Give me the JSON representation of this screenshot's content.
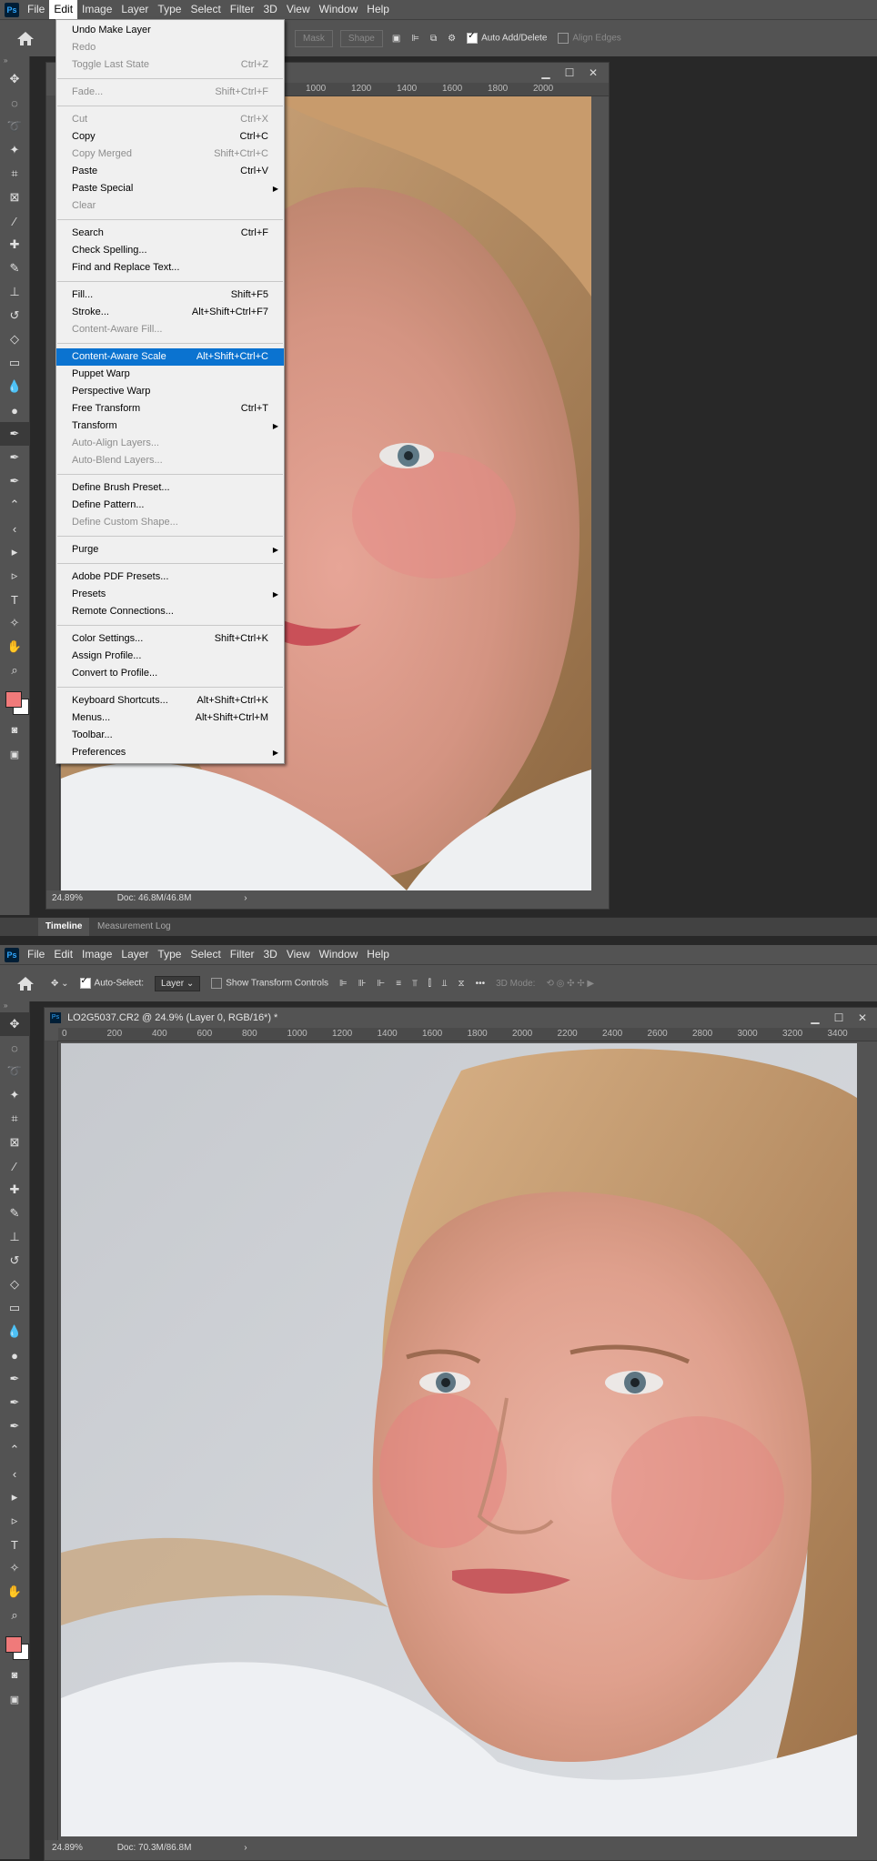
{
  "menubar": {
    "logo": "Ps",
    "items": [
      "File",
      "Edit",
      "Image",
      "Layer",
      "Type",
      "Select",
      "Filter",
      "3D",
      "View",
      "Window",
      "Help"
    ]
  },
  "top_options": {
    "mask_label": "Mask",
    "shape_label": "Shape",
    "auto_add_delete": "Auto Add/Delete",
    "align_edges": "Align Edges"
  },
  "top_document": {
    "ruler_ticks": [
      "1000",
      "1200",
      "1400",
      "1600",
      "1800",
      "2000"
    ],
    "zoom": "24.89%",
    "doc_info": "Doc: 46.8M/46.8M"
  },
  "edit_menu": {
    "groups": [
      [
        {
          "label": "Undo Make Layer",
          "shortcut": "",
          "enabled": true
        },
        {
          "label": "Redo",
          "shortcut": "",
          "enabled": false
        },
        {
          "label": "Toggle Last State",
          "shortcut": "Ctrl+Z",
          "enabled": false
        }
      ],
      [
        {
          "label": "Fade...",
          "shortcut": "Shift+Ctrl+F",
          "enabled": false
        }
      ],
      [
        {
          "label": "Cut",
          "shortcut": "Ctrl+X",
          "enabled": false
        },
        {
          "label": "Copy",
          "shortcut": "Ctrl+C",
          "enabled": true
        },
        {
          "label": "Copy Merged",
          "shortcut": "Shift+Ctrl+C",
          "enabled": false
        },
        {
          "label": "Paste",
          "shortcut": "Ctrl+V",
          "enabled": true
        },
        {
          "label": "Paste Special",
          "shortcut": "",
          "enabled": true,
          "submenu": true
        },
        {
          "label": "Clear",
          "shortcut": "",
          "enabled": false
        }
      ],
      [
        {
          "label": "Search",
          "shortcut": "Ctrl+F",
          "enabled": true
        },
        {
          "label": "Check Spelling...",
          "shortcut": "",
          "enabled": true
        },
        {
          "label": "Find and Replace Text...",
          "shortcut": "",
          "enabled": true
        }
      ],
      [
        {
          "label": "Fill...",
          "shortcut": "Shift+F5",
          "enabled": true
        },
        {
          "label": "Stroke...",
          "shortcut": "Alt+Shift+Ctrl+F7",
          "enabled": true
        },
        {
          "label": "Content-Aware Fill...",
          "shortcut": "",
          "enabled": false
        }
      ],
      [
        {
          "label": "Content-Aware Scale",
          "shortcut": "Alt+Shift+Ctrl+C",
          "enabled": true,
          "highlighted": true
        },
        {
          "label": "Puppet Warp",
          "shortcut": "",
          "enabled": true
        },
        {
          "label": "Perspective Warp",
          "shortcut": "",
          "enabled": true
        },
        {
          "label": "Free Transform",
          "shortcut": "Ctrl+T",
          "enabled": true
        },
        {
          "label": "Transform",
          "shortcut": "",
          "enabled": true,
          "submenu": true
        },
        {
          "label": "Auto-Align Layers...",
          "shortcut": "",
          "enabled": false
        },
        {
          "label": "Auto-Blend Layers...",
          "shortcut": "",
          "enabled": false
        }
      ],
      [
        {
          "label": "Define Brush Preset...",
          "shortcut": "",
          "enabled": true
        },
        {
          "label": "Define Pattern...",
          "shortcut": "",
          "enabled": true
        },
        {
          "label": "Define Custom Shape...",
          "shortcut": "",
          "enabled": false
        }
      ],
      [
        {
          "label": "Purge",
          "shortcut": "",
          "enabled": true,
          "submenu": true
        }
      ],
      [
        {
          "label": "Adobe PDF Presets...",
          "shortcut": "",
          "enabled": true
        },
        {
          "label": "Presets",
          "shortcut": "",
          "enabled": true,
          "submenu": true
        },
        {
          "label": "Remote Connections...",
          "shortcut": "",
          "enabled": true
        }
      ],
      [
        {
          "label": "Color Settings...",
          "shortcut": "Shift+Ctrl+K",
          "enabled": true
        },
        {
          "label": "Assign Profile...",
          "shortcut": "",
          "enabled": true
        },
        {
          "label": "Convert to Profile...",
          "shortcut": "",
          "enabled": true
        }
      ],
      [
        {
          "label": "Keyboard Shortcuts...",
          "shortcut": "Alt+Shift+Ctrl+K",
          "enabled": true
        },
        {
          "label": "Menus...",
          "shortcut": "Alt+Shift+Ctrl+M",
          "enabled": true
        },
        {
          "label": "Toolbar...",
          "shortcut": "",
          "enabled": true
        },
        {
          "label": "Preferences",
          "shortcut": "",
          "enabled": true,
          "submenu": true
        }
      ]
    ]
  },
  "panel_tabs": {
    "timeline": "Timeline",
    "measurement_log": "Measurement Log"
  },
  "bottom_options": {
    "auto_select": "Auto-Select:",
    "layer_select": "Layer",
    "show_transform": "Show Transform Controls",
    "mode_3d": "3D Mode:"
  },
  "bottom_document": {
    "title": "LO2G5037.CR2 @ 24.9% (Layer 0, RGB/16*) *",
    "ruler_ticks": [
      "0",
      "200",
      "400",
      "600",
      "800",
      "1000",
      "1200",
      "1400",
      "1600",
      "1800",
      "2000",
      "2200",
      "2400",
      "2600",
      "2800",
      "3000",
      "3200",
      "3400"
    ],
    "zoom": "24.89%",
    "doc_info": "Doc: 70.3M/86.8M"
  },
  "colors": {
    "chrome": "#535353",
    "workspace": "#282828",
    "highlight": "#0b73d0",
    "foreground_swatch": "#f07a7a",
    "background_swatch": "#ffffff"
  },
  "tools": [
    "move-tool",
    "marquee-tool",
    "lasso-tool",
    "magic-wand-tool",
    "crop-tool",
    "frame-tool",
    "eyedropper-tool",
    "healing-brush-tool",
    "brush-tool",
    "clone-stamp-tool",
    "history-brush-tool",
    "eraser-tool",
    "gradient-tool",
    "blur-tool",
    "dodge-tool",
    "pen-tool",
    "freeform-pen-tool",
    "curvature-pen-tool",
    "add-anchor-tool",
    "convert-point-tool",
    "path-selection-tool",
    "direct-selection-tool",
    "type-tool",
    "custom-shape-tool",
    "hand-tool",
    "zoom-tool"
  ]
}
